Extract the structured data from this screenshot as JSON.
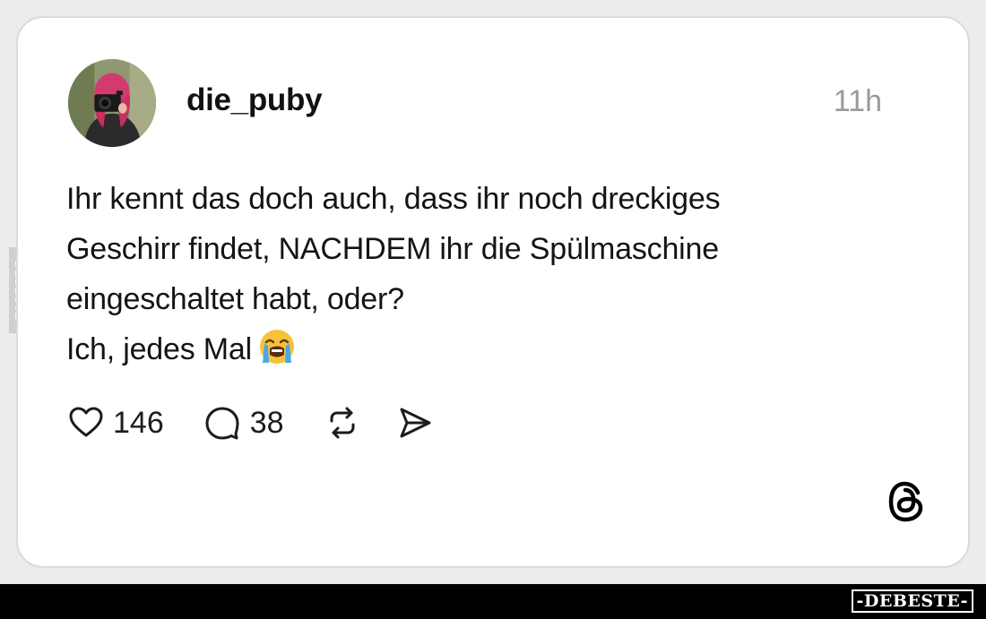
{
  "post": {
    "username": "die_puby",
    "timestamp": "11h",
    "text_lines": [
      "Ihr kennt das doch auch, dass ihr noch dreckiges",
      "Geschirr findet, NACHDEM ihr die Spülmaschine",
      "eingeschaltet habt, oder?",
      "Ich, jedes Mal"
    ],
    "emoji": "loudly-crying-face-icon"
  },
  "actions": {
    "like_icon": "heart-icon",
    "like_count": "146",
    "comment_icon": "comment-bubble-icon",
    "comment_count": "38",
    "repost_icon": "repost-icon",
    "share_icon": "send-icon"
  },
  "branding": {
    "app_icon": "threads-logo-icon",
    "side_watermark": "DEBESTE",
    "footer_watermark": "-DEBESTE-"
  },
  "colors": {
    "background": "#ececec",
    "card": "#ffffff",
    "card_border": "#dadada",
    "text": "#141414",
    "muted": "#9a9a9a",
    "footer": "#000000"
  }
}
